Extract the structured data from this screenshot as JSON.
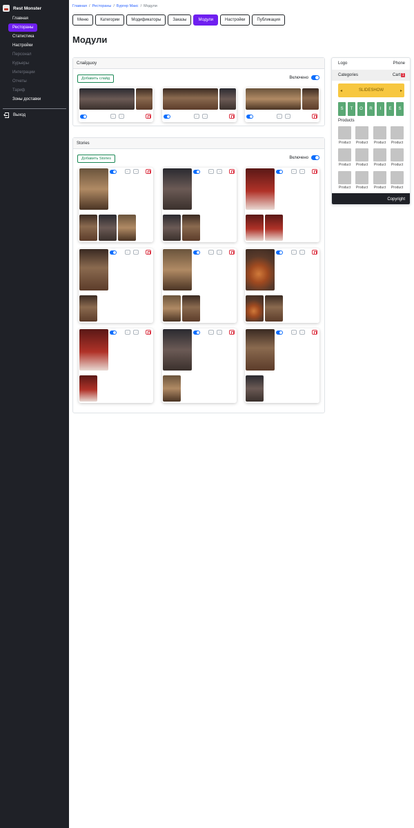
{
  "sidebar": {
    "brand": "Rest Monster",
    "items": [
      {
        "label": "Главная",
        "state": "normal"
      },
      {
        "label": "Рестораны",
        "state": "active"
      },
      {
        "label": "Статистика",
        "state": "normal"
      },
      {
        "label": "Настройки",
        "state": "normal"
      },
      {
        "label": "Персонал",
        "state": "dim"
      },
      {
        "label": "Курьеры",
        "state": "dim"
      },
      {
        "label": "Интеграции",
        "state": "dim"
      },
      {
        "label": "Отчеты",
        "state": "dim"
      },
      {
        "label": "Тариф",
        "state": "dim"
      },
      {
        "label": "Зоны доставки",
        "state": "normal"
      }
    ],
    "logout": "Выход"
  },
  "breadcrumb": [
    "Главная",
    "Рестораны",
    "Бургер Макс",
    "Модули"
  ],
  "tabs": [
    {
      "label": "Меню"
    },
    {
      "label": "Категории"
    },
    {
      "label": "Модификаторы"
    },
    {
      "label": "Заказы"
    },
    {
      "label": "Модули",
      "active": true
    },
    {
      "label": "Настройки"
    },
    {
      "label": "Публикация"
    }
  ],
  "page_title": "Модули",
  "slideshow": {
    "title": "Слайдшоу",
    "add_button": "Добавить слайд",
    "enabled_label": "Включено",
    "enabled": true
  },
  "stories": {
    "title": "Stories",
    "add_button": "Добавить Stories",
    "enabled_label": "Включено",
    "enabled": true
  },
  "arrows": {
    "left": "←",
    "right": "→"
  },
  "preview": {
    "logo": "Logo",
    "phone": "Phone",
    "categories": "Categories",
    "cart": "Cart",
    "cart_count": "1",
    "slideshow": "SLIDESHOW",
    "prev": "◂",
    "next": "▸",
    "stories_letters": [
      "S",
      "T",
      "O",
      "R",
      "I",
      "E",
      "S"
    ],
    "products_title": "Products",
    "product_label": "Product",
    "copyright": "Copyright"
  },
  "colors": {
    "sidebar_bg": "#1f2127",
    "accent": "#6f1ff0",
    "toggle": "#0d6efd",
    "add_button": "#198754",
    "delete": "#dc3545",
    "slideshow_bar": "#f7c740",
    "stories_tiles": "#5aa874"
  }
}
